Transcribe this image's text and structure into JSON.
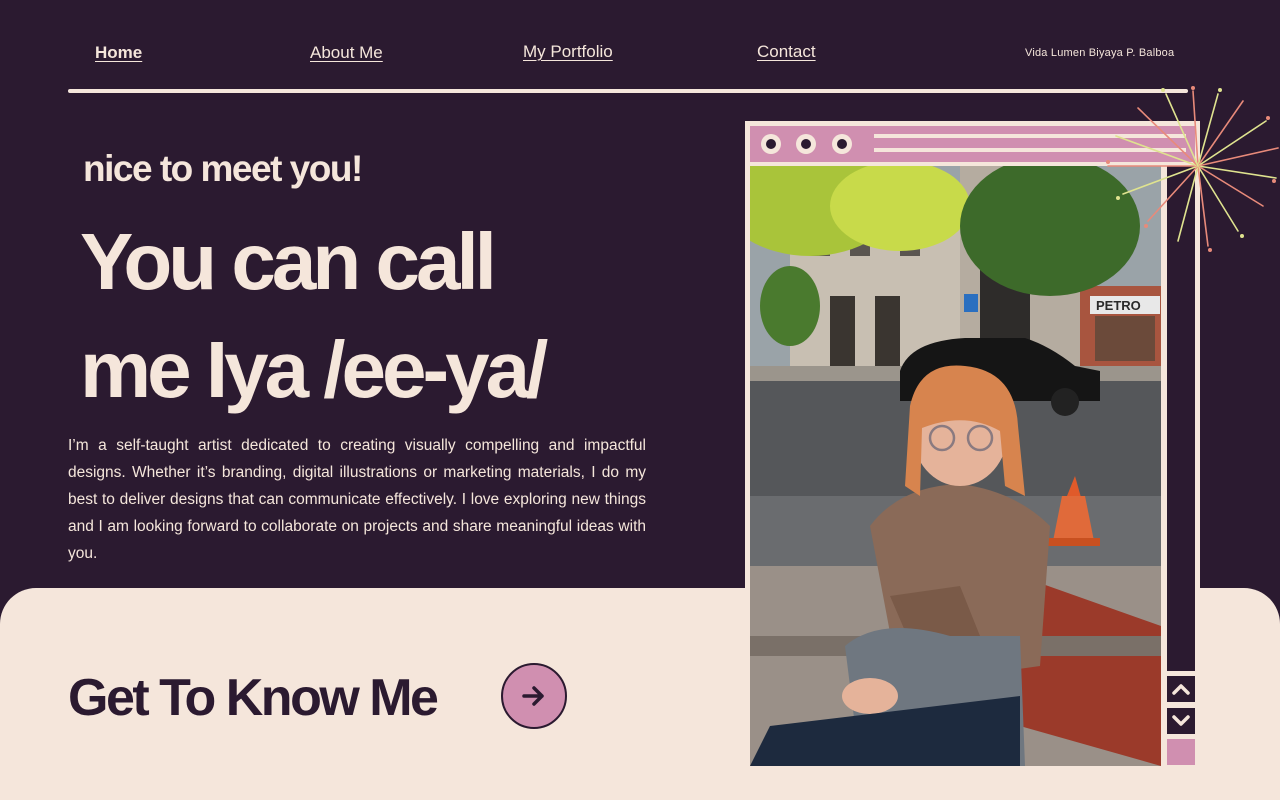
{
  "nav": {
    "home": "Home",
    "about": "About Me",
    "portfolio": "My Portfolio",
    "contact": "Contact",
    "owner_name": "Vida Lumen Biyaya P. Balboa"
  },
  "hero": {
    "greeting": "nice to meet you!",
    "headline_line1": "You can call",
    "headline_line2": "me Iya /ee-ya/",
    "bio": "I’m a self-taught artist dedicated to creating visually compelling and impactful designs. Whether it’s branding, digital illustrations or marketing materials, I do my best to deliver designs that can communicate effectively. I love exploring new things and I am looking forward to collaborate on projects and share meaningful ideas with you."
  },
  "cta": {
    "label": "Get To Know Me",
    "icon": "arrow-right-icon"
  },
  "photo_window": {
    "icons": [
      "window-dot-icon",
      "window-dot-icon",
      "window-dot-icon",
      "chevron-up-icon",
      "chevron-down-icon",
      "firework-icon"
    ],
    "sign_text": "PETRO"
  },
  "colors": {
    "background": "#2b1a30",
    "cream": "#f5e6db",
    "pink": "#d08fb0",
    "firework_salmon": "#e88a7a",
    "firework_yellow": "#dfe38f"
  }
}
